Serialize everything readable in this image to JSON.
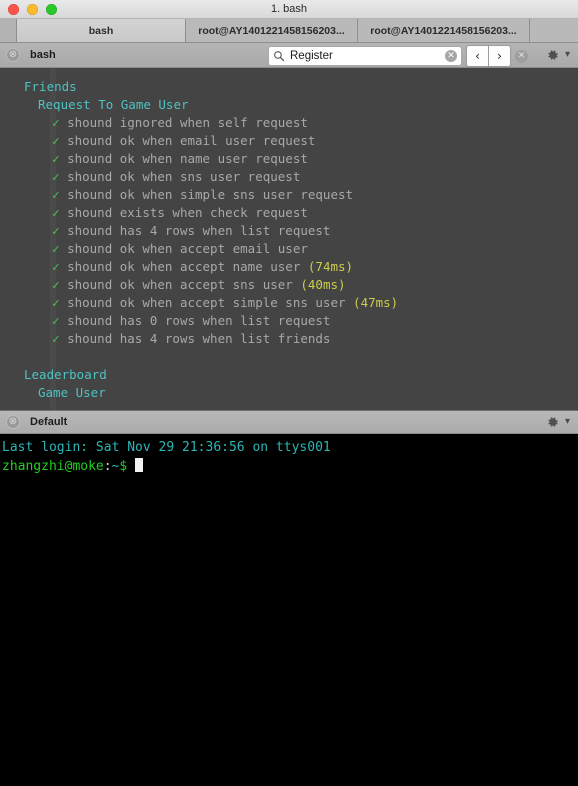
{
  "window": {
    "title": "1. bash",
    "traffic_lights": [
      "close-red",
      "minimize-yellow",
      "maximize-green"
    ]
  },
  "tabs": [
    {
      "label": "bash",
      "active": true
    },
    {
      "label": "root@AY1401221458156203...",
      "active": false
    },
    {
      "label": "root@AY1401221458156203...",
      "active": false
    }
  ],
  "top_pane": {
    "close_label": "⊗",
    "title": "bash",
    "gear_icon": "gear-icon",
    "chevron_icon": "chevron-down-icon"
  },
  "search": {
    "icon": "search-icon",
    "value": "Register",
    "placeholder": "Search",
    "clear_label": "✕",
    "prev_label": "‹",
    "next_label": "›",
    "dismiss_label": "✕"
  },
  "bottom_pane": {
    "close_label": "⊗",
    "title": "Default",
    "gear_icon": "gear-icon",
    "chevron_icon": "chevron-down-icon"
  },
  "terminal_top": {
    "suites": [
      {
        "name": "Friends",
        "indent": 1
      },
      {
        "name": "Request To Game User",
        "indent": 2
      }
    ],
    "tick": "✓",
    "tests": [
      {
        "text": "shound ignored when self request",
        "duration": ""
      },
      {
        "text": "shound ok when email user request",
        "duration": ""
      },
      {
        "text": "shound ok when name user request",
        "duration": ""
      },
      {
        "text": "shound ok when sns user request",
        "duration": ""
      },
      {
        "text": "shound ok when simple sns user request",
        "duration": ""
      },
      {
        "text": "shound exists when check request",
        "duration": ""
      },
      {
        "text": "shound has 4 rows when list request",
        "duration": ""
      },
      {
        "text": "shound ok when accept email user",
        "duration": ""
      },
      {
        "text": "shound ok when accept name user",
        "duration": "(74ms)"
      },
      {
        "text": "shound ok when accept sns user",
        "duration": "(40ms)"
      },
      {
        "text": "shound ok when accept simple sns user",
        "duration": "(47ms)"
      },
      {
        "text": "shound has 0 rows when list request",
        "duration": ""
      },
      {
        "text": "shound has 4 rows when list friends",
        "duration": ""
      }
    ],
    "suites_after": [
      {
        "name": "Leaderboard",
        "indent": 1
      },
      {
        "name": "Game User",
        "indent": 2
      }
    ]
  },
  "terminal_bottom": {
    "last_login": "Last login: Sat Nov 29 21:36:56 on ttys001",
    "prompt_user_host": "zhangzhi@moke",
    "prompt_colon": ":",
    "prompt_path": "~",
    "prompt_symbol": "$",
    "cursor": "block"
  },
  "colors": {
    "terminal_top_bg": "#444444",
    "terminal_bottom_bg": "#000000",
    "suite_text": "#4fc1c1",
    "test_text": "#a8a8a8",
    "tick_green": "#3ec74f",
    "duration_yellow": "#cdcd49",
    "prompt_green": "#21cf21",
    "login_cyan": "#2bb5b5"
  }
}
